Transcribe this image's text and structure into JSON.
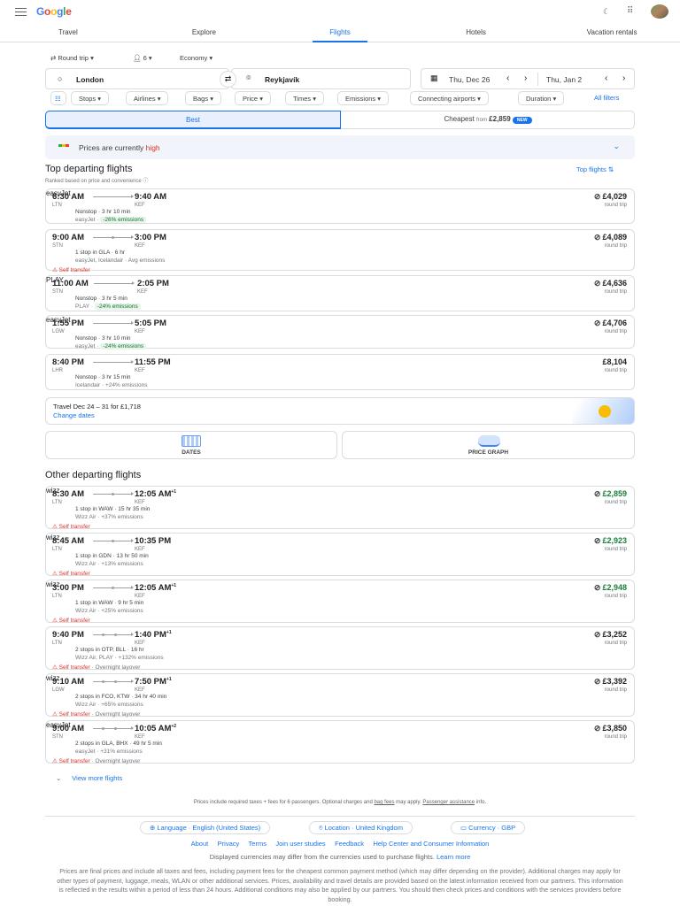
{
  "header": {
    "logo": "Google"
  },
  "tabs": [
    {
      "label": "Travel"
    },
    {
      "label": "Explore"
    },
    {
      "label": "Flights",
      "active": true
    },
    {
      "label": "Hotels"
    },
    {
      "label": "Vacation rentals"
    }
  ],
  "search": {
    "trip_type": "Round trip",
    "passengers": "6",
    "cabin": "Economy",
    "origin": "London",
    "destination": "Reykjavík",
    "depart_date": "Thu, Dec 26",
    "return_date": "Thu, Jan 2"
  },
  "filters": [
    "Stops",
    "Airlines",
    "Bags",
    "Price",
    "Times",
    "Emissions",
    "Connecting airports",
    "Duration"
  ],
  "all_filters": "All filters",
  "sort": {
    "best": "Best",
    "cheapest": "Cheapest",
    "from": "from",
    "cheapest_price": "£2,859",
    "new_badge": "NEW"
  },
  "insight": {
    "text": "Prices are currently",
    "level": "high"
  },
  "top": {
    "title": "Top departing flights",
    "subtitle": "Ranked based on price and convenience",
    "sort_label": "Top flights"
  },
  "top_flights": [
    {
      "dep": "6:30 AM",
      "arr": "9:40 AM",
      "from": "LTN",
      "to": "KEF",
      "stops": 0,
      "line1": "Nonstop · 3 hr 10 min",
      "airline": "easyJet",
      "emissions": "-26% emissions",
      "em_good": true,
      "price": "£4,029",
      "bag": true,
      "logo": "easyjet"
    },
    {
      "dep": "9:00 AM",
      "arr": "3:00 PM",
      "from": "STN",
      "to": "KEF",
      "stops": 1,
      "line1": "1 stop in GLA · 6 hr",
      "airline": "easyJet, Icelandair",
      "emissions": "Avg emissions",
      "warn": "Self transfer",
      "price": "£4,089",
      "bag": true,
      "logo": "multi"
    },
    {
      "dep": "11:00 AM",
      "arr": "2:05 PM",
      "from": "STN",
      "to": "KEF",
      "stops": 0,
      "line1": "Nonstop · 3 hr 5 min",
      "airline": "PLAY",
      "emissions": "-24% emissions",
      "em_good": true,
      "price": "£4,636",
      "bag": true,
      "logo": "play"
    },
    {
      "dep": "1:55 PM",
      "arr": "5:05 PM",
      "from": "LGW",
      "to": "KEF",
      "stops": 0,
      "line1": "Nonstop · 3 hr 10 min",
      "airline": "easyJet",
      "emissions": "-24% emissions",
      "em_good": true,
      "price": "£4,706",
      "bag": true,
      "logo": "easyjet"
    },
    {
      "dep": "8:40 PM",
      "arr": "11:55 PM",
      "from": "LHR",
      "to": "KEF",
      "stops": 0,
      "line1": "Nonstop · 3 hr 15 min",
      "airline": "Icelandair",
      "emissions": "+24% emissions",
      "price": "£8,104",
      "bag": false,
      "logo": "icelandair"
    }
  ],
  "round_trip": "round trip",
  "date_tip": {
    "text": "Travel Dec 24 – 31 for £1,718",
    "link": "Change dates"
  },
  "tools": {
    "dates": "DATES",
    "price_graph": "PRICE GRAPH"
  },
  "other": {
    "title": "Other departing flights"
  },
  "other_flights": [
    {
      "dep": "8:30 AM",
      "arr": "12:05 AM",
      "arr_sup": "+1",
      "from": "LTN",
      "to": "KEF",
      "stops": 1,
      "line1": "1 stop in WAW · 15 hr 35 min",
      "airline": "Wizz Air",
      "emissions": "+37% emissions",
      "warn": "Self transfer",
      "price": "£2,859",
      "green": true,
      "bag": true,
      "logo": "wizz"
    },
    {
      "dep": "8:45 AM",
      "arr": "10:35 PM",
      "from": "LTN",
      "to": "KEF",
      "stops": 1,
      "line1": "1 stop in GDN · 13 hr 50 min",
      "airline": "Wizz Air",
      "emissions": "+13% emissions",
      "warn": "Self transfer",
      "price": "£2,923",
      "green": true,
      "bag": true,
      "logo": "wizz"
    },
    {
      "dep": "3:00 PM",
      "arr": "12:05 AM",
      "arr_sup": "+1",
      "from": "LTN",
      "to": "KEF",
      "stops": 1,
      "line1": "1 stop in WAW · 9 hr 5 min",
      "airline": "Wizz Air",
      "emissions": "+25% emissions",
      "warn": "Self transfer",
      "price": "£2,948",
      "green": true,
      "bag": true,
      "logo": "wizz"
    },
    {
      "dep": "9:40 PM",
      "arr": "1:40 PM",
      "arr_sup": "+1",
      "from": "LTN",
      "to": "KEF",
      "stops": 2,
      "line1": "2 stops in OTP, BLL · 16 hr",
      "airline": "Wizz Air, PLAY",
      "emissions": "+132% emissions",
      "warn": "Self transfer",
      "warn2": "Overnight layover",
      "price": "£3,252",
      "bag": true,
      "logo": "multi"
    },
    {
      "dep": "9:10 AM",
      "arr": "7:50 PM",
      "arr_sup": "+1",
      "from": "LGW",
      "to": "KEF",
      "stops": 2,
      "line1": "2 stops in FCO, KTW · 34 hr 40 min",
      "airline": "Wizz Air",
      "emissions": "+65% emissions",
      "warn": "Self transfer",
      "warn2": "Overnight layover",
      "price": "£3,392",
      "bag": true,
      "logo": "wizz"
    },
    {
      "dep": "9:00 AM",
      "arr": "10:05 AM",
      "arr_sup": "+2",
      "from": "STN",
      "to": "KEF",
      "stops": 2,
      "line1": "2 stops in GLA, BHX · 49 hr 5 min",
      "airline": "easyJet",
      "emissions": "+31% emissions",
      "warn": "Self transfer",
      "warn2": "Overnight layover",
      "price": "£3,850",
      "bag": true,
      "logo": "easyjet"
    }
  ],
  "view_more": "View more flights",
  "footer": {
    "note_a": "Prices include required taxes + fees for 6 passengers. Optional charges and",
    "bag_fees": "bag fees",
    "note_b": "may apply.",
    "passenger_assistance": "Passenger assistance",
    "note_c": "info.",
    "language": "Language · English (United States)",
    "location": "Location · United Kingdom",
    "currency": "Currency · GBP",
    "links": [
      "About",
      "Privacy",
      "Terms",
      "Join user studies",
      "Feedback",
      "Help Center and Consumer Information"
    ],
    "currency_note": "Displayed currencies may differ from the currencies used to purchase flights.",
    "learn_more": "Learn more",
    "disclaimer": "Prices are final prices and include all taxes and fees, including payment fees for the cheapest common payment method (which may differ depending on the provider). Additional charges may apply for other types of payment, luggage, meals, WLAN or other additional services. Prices, availability and travel details are provided based on the latest information received from our partners. This information is reflected in the results within a period of less than 24 hours. Additional conditions may also be applied by our partners. You should then check prices and conditions with the services providers before booking."
  },
  "colors": {
    "accent": "#1a73e8",
    "high": "#d93025",
    "green": "#188038",
    "easyjet": "#ff6600",
    "play": "#e4032c",
    "icelandair": "#003a7d",
    "wizz": "#c6007e"
  }
}
